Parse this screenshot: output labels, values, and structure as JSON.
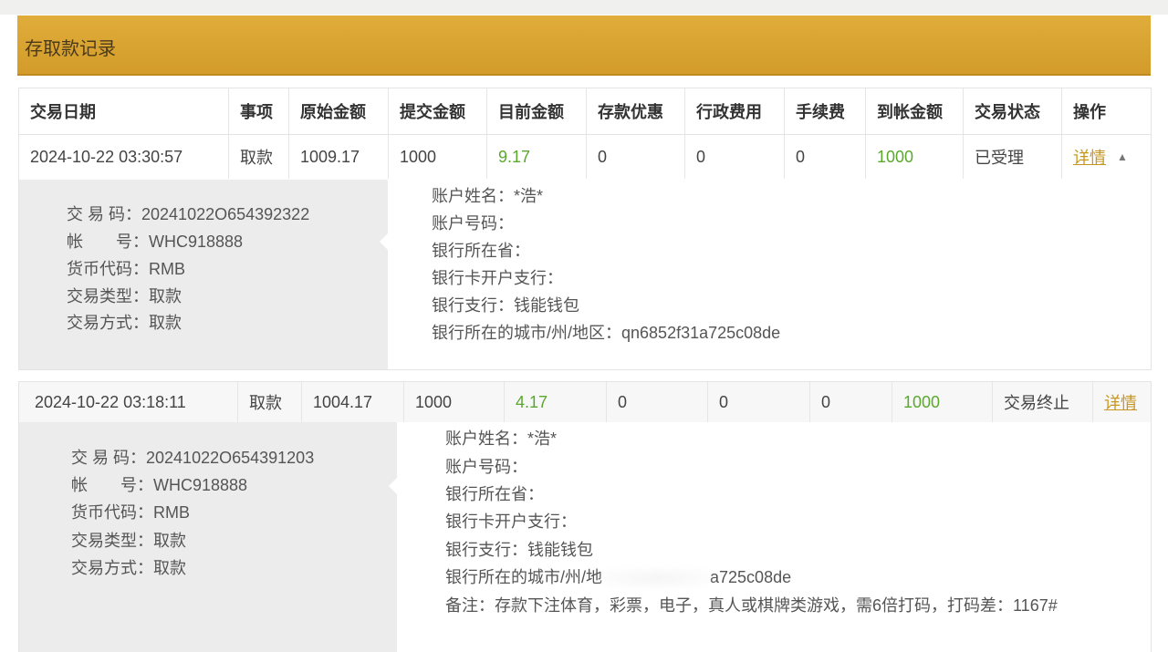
{
  "header": {
    "title": "存取款记录"
  },
  "table": {
    "columns": [
      "交易日期",
      "事项",
      "原始金额",
      "提交金额",
      "目前金额",
      "存款优惠",
      "行政费用",
      "手续费",
      "到帐金额",
      "交易状态",
      "操作"
    ]
  },
  "records": [
    {
      "date": "2024-10-22 03:30:57",
      "item": "取款",
      "original": "1009.17",
      "submitted": "1000",
      "current": "9.17",
      "bonus": "0",
      "admin_fee": "0",
      "fee": "0",
      "received": "1000",
      "status": "已受理",
      "action": "详情",
      "caret": "▲",
      "detail": {
        "left": [
          {
            "label": "交 易 码：",
            "value": "20241022O654392322"
          },
          {
            "label": "帐　　号：",
            "value": "WHC918888"
          },
          {
            "label": "货币代码：",
            "value": "RMB"
          },
          {
            "label": "交易类型：",
            "value": "取款"
          },
          {
            "label": "交易方式：",
            "value": "取款"
          }
        ],
        "right": [
          {
            "label": "账户姓名：",
            "value": "*浩*"
          },
          {
            "label": "账户号码：",
            "value": ""
          },
          {
            "label": "银行所在省：",
            "value": ""
          },
          {
            "label": "银行卡开户支行：",
            "value": ""
          },
          {
            "label": "银行支行：",
            "value": "钱能钱包"
          },
          {
            "label": "银行所在的城市/州/地区：",
            "value": "qn6852f31a725c08de"
          }
        ]
      }
    },
    {
      "date": "2024-10-22 03:18:11",
      "item": "取款",
      "original": "1004.17",
      "submitted": "1000",
      "current": "4.17",
      "bonus": "0",
      "admin_fee": "0",
      "fee": "0",
      "received": "1000",
      "status": "交易终止",
      "action": "详情",
      "detail": {
        "left": [
          {
            "label": "交 易 码：",
            "value": "20241022O654391203"
          },
          {
            "label": "帐　　号：",
            "value": "WHC918888"
          },
          {
            "label": "货币代码：",
            "value": "RMB"
          },
          {
            "label": "交易类型：",
            "value": "取款"
          },
          {
            "label": "交易方式：",
            "value": "取款"
          }
        ],
        "right": [
          {
            "label": "账户姓名：",
            "value": "*浩*"
          },
          {
            "label": "账户号码：",
            "value": ""
          },
          {
            "label": "银行所在省：",
            "value": ""
          },
          {
            "label": "银行卡开户支行：",
            "value": ""
          },
          {
            "label": "银行支行：",
            "value": "钱能钱包"
          },
          {
            "label": "银行所在的城市/州/地",
            "value": "a725c08de"
          },
          {
            "label": "备注：",
            "value": "存款下注体育，彩票，电子，真人或棋牌类游戏，需6倍打码，打码差：1167#"
          }
        ]
      }
    }
  ],
  "colors": {
    "header_gold": "#d9a332",
    "positive_green": "#5aa82e",
    "link_gold": "#c8961e"
  }
}
